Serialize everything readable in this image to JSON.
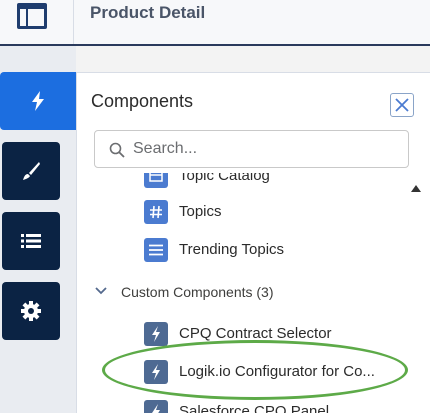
{
  "header": {
    "title": "Product Detail",
    "icon": "layout-grid-icon"
  },
  "rail": [
    {
      "name": "components-tab",
      "icon": "lightning-icon",
      "active": true
    },
    {
      "name": "theme-tab",
      "icon": "brush-icon",
      "active": false
    },
    {
      "name": "pages-tab",
      "icon": "list-icon",
      "active": false
    },
    {
      "name": "settings-tab",
      "icon": "gear-icon",
      "active": false
    }
  ],
  "panel": {
    "title": "Components",
    "close_icon": "close-icon",
    "search": {
      "placeholder": "Search...",
      "value": ""
    },
    "items": [
      {
        "label": "Topic Catalog",
        "icon": "catalog-icon"
      },
      {
        "label": "Topics",
        "icon": "hash-icon"
      },
      {
        "label": "Trending Topics",
        "icon": "list-icon"
      }
    ],
    "section": {
      "label": "Custom Components (3)",
      "expanded": true
    },
    "custom_items": [
      {
        "label": "CPQ Contract Selector",
        "icon": "lightning-icon"
      },
      {
        "label": "Logik.io Configurator for Co...",
        "icon": "lightning-icon"
      },
      {
        "label": "Salesforce CPQ Panel",
        "icon": "lightning-icon"
      }
    ]
  },
  "colors": {
    "rail_active": "#1c6ee0",
    "rail_dark": "#0b2344",
    "icon_blue": "#4b7bd0",
    "highlight_green": "#5daa48"
  }
}
